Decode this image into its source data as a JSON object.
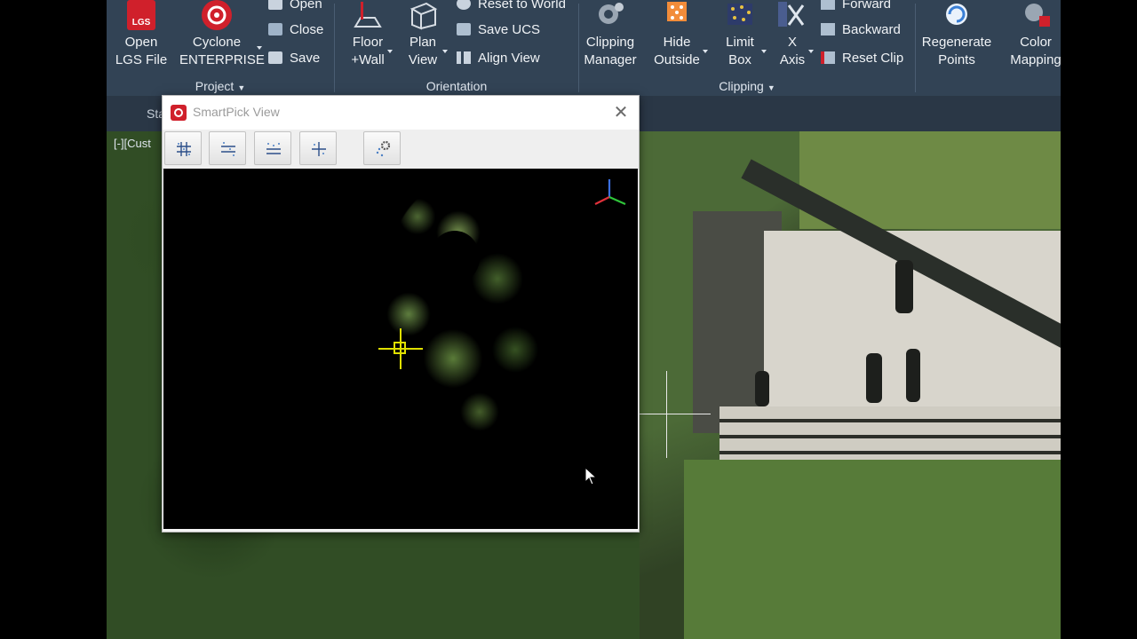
{
  "ribbon": {
    "project": {
      "group_label": "Project",
      "open_lgs": {
        "label": "Open\nLGS File",
        "icon": "lgs-file-icon",
        "icon_text": "LGS"
      },
      "cyclone": {
        "label": "Cyclone\nENTERPRISE",
        "icon": "cyclone-icon"
      },
      "open": {
        "label": "Open",
        "icon": "open-folder-icon"
      },
      "close": {
        "label": "Close",
        "icon": "close-file-icon"
      },
      "save": {
        "label": "Save",
        "icon": "save-icon"
      }
    },
    "orientation": {
      "group_label": "Orientation",
      "floor_wall": {
        "label": "Floor\n+Wall",
        "icon": "floor-wall-icon"
      },
      "plan_view": {
        "label": "Plan\nView",
        "icon": "plan-view-icon"
      },
      "reset_world": {
        "label": "Reset to World",
        "icon": "reset-world-icon"
      },
      "save_ucs": {
        "label": "Save UCS",
        "icon": "save-ucs-icon"
      },
      "align_view": {
        "label": "Align View",
        "icon": "align-view-icon"
      }
    },
    "clipping": {
      "group_label": "Clipping",
      "clipping_manager": {
        "label": "Clipping\nManager",
        "icon": "clipping-manager-icon"
      },
      "hide_outside": {
        "label": "Hide\nOutside",
        "icon": "hide-outside-icon"
      },
      "limit_box": {
        "label": "Limit\nBox",
        "icon": "limit-box-icon"
      },
      "x_axis": {
        "label": "X\nAxis",
        "icon": "x-axis-icon"
      },
      "forward": {
        "label": "Forward",
        "icon": "forward-icon"
      },
      "backward": {
        "label": "Backward",
        "icon": "backward-icon"
      },
      "reset_clip": {
        "label": "Reset Clip",
        "icon": "reset-clip-icon"
      }
    },
    "points": {
      "regenerate": {
        "label": "Regenerate\nPoints",
        "icon": "regenerate-points-icon"
      },
      "color_mapping": {
        "label": "Color\nMapping",
        "icon": "color-mapping-icon"
      }
    }
  },
  "tabstrip": {
    "tab_label": "Sta"
  },
  "viewport": {
    "label": "[-][Cust"
  },
  "dialog": {
    "title": "SmartPick View",
    "close_glyph": "✕",
    "toolbar": [
      {
        "name": "smartpick-top-view-button",
        "icon": "top-view-grid-icon"
      },
      {
        "name": "smartpick-front-view-button",
        "icon": "front-view-grid-icon"
      },
      {
        "name": "smartpick-side-view-button",
        "icon": "side-view-grid-icon"
      },
      {
        "name": "smartpick-center-view-button",
        "icon": "center-view-grid-icon"
      },
      {
        "name": "smartpick-settings-button",
        "icon": "settings-gear-icon"
      }
    ]
  },
  "colors": {
    "ribbon_bg": "#324355",
    "dialog_bg": "#f4f4f4",
    "brand_red": "#d0202b",
    "pick_cursor": "#e0e000"
  }
}
